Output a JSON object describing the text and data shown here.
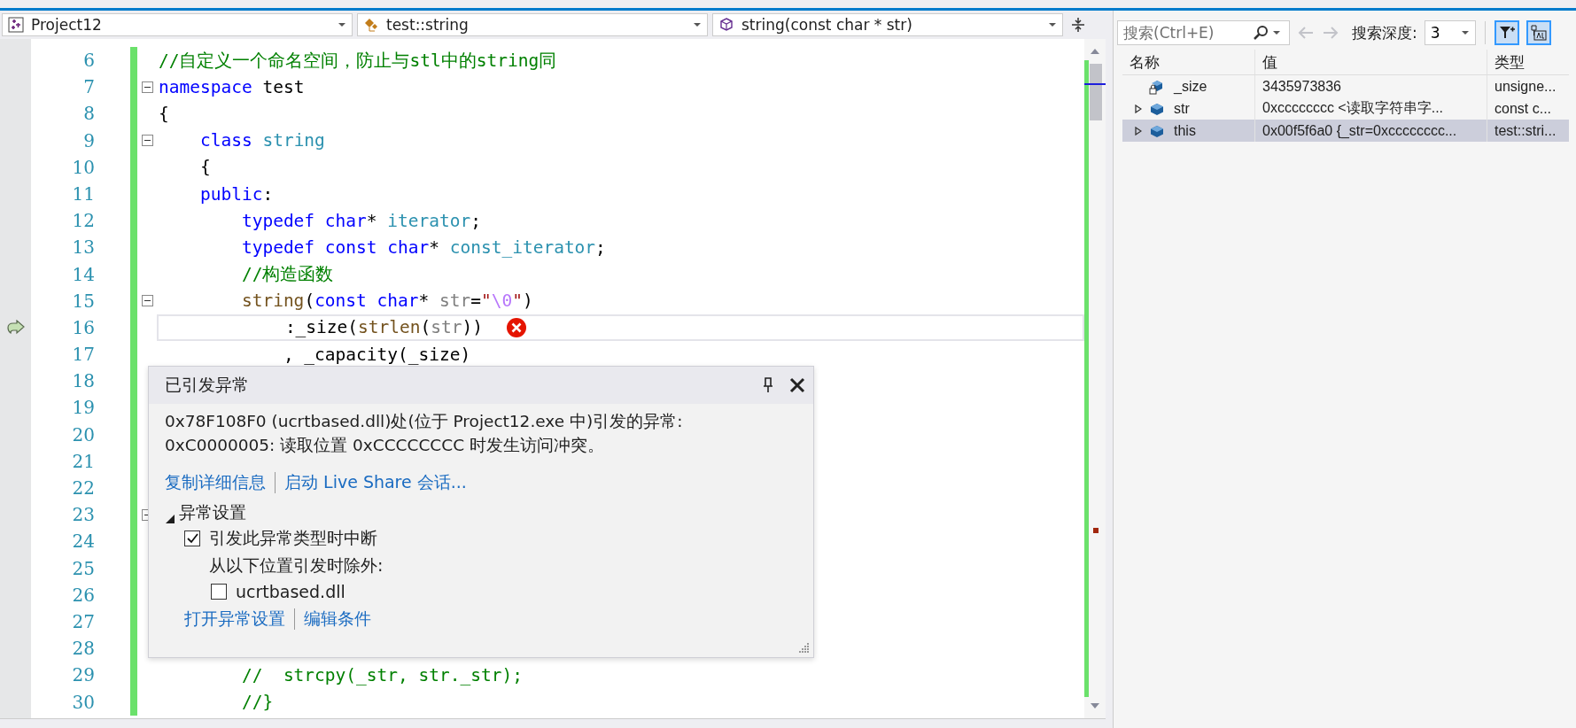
{
  "navigation_bar": [
    {
      "kind": "project",
      "label": "Project12"
    },
    {
      "kind": "class",
      "label": "test::string"
    },
    {
      "kind": "member",
      "label": "string(const char * str)"
    }
  ],
  "editor": {
    "lines": [
      {
        "number": "6",
        "foldable": false,
        "current": false,
        "error": false,
        "tokens": [
          {
            "text": "//自定义一个命名空间，防止与stl中的string同",
            "kind": "comment"
          }
        ]
      },
      {
        "number": "7",
        "foldable": true,
        "current": false,
        "error": false,
        "tokens": [
          {
            "text": "namespace",
            "kind": "keyword"
          },
          {
            "text": " test",
            "kind": "plain"
          }
        ]
      },
      {
        "number": "8",
        "foldable": false,
        "current": false,
        "error": false,
        "tokens": [
          {
            "text": "{",
            "kind": "plain"
          }
        ]
      },
      {
        "number": "9",
        "foldable": true,
        "current": false,
        "error": false,
        "tokens": [
          {
            "text": "    class",
            "kind": "keyword"
          },
          {
            "text": " string",
            "kind": "type"
          }
        ]
      },
      {
        "number": "10",
        "foldable": false,
        "current": false,
        "error": false,
        "tokens": [
          {
            "text": "    {",
            "kind": "plain"
          }
        ]
      },
      {
        "number": "11",
        "foldable": false,
        "current": false,
        "error": false,
        "tokens": [
          {
            "text": "    public",
            "kind": "keyword"
          },
          {
            "text": ":",
            "kind": "plain"
          }
        ]
      },
      {
        "number": "12",
        "foldable": false,
        "current": false,
        "error": false,
        "tokens": [
          {
            "text": "        typedef char",
            "kind": "keyword"
          },
          {
            "text": "*",
            "kind": "plain"
          },
          {
            "text": " iterator",
            "kind": "type"
          },
          {
            "text": ";",
            "kind": "plain"
          }
        ]
      },
      {
        "number": "13",
        "foldable": false,
        "current": false,
        "error": false,
        "tokens": [
          {
            "text": "        typedef const char",
            "kind": "keyword"
          },
          {
            "text": "*",
            "kind": "plain"
          },
          {
            "text": " const_iterator",
            "kind": "type"
          },
          {
            "text": ";",
            "kind": "plain"
          }
        ]
      },
      {
        "number": "14",
        "foldable": false,
        "current": false,
        "error": false,
        "tokens": [
          {
            "text": "        //构造函数",
            "kind": "comment"
          }
        ]
      },
      {
        "number": "15",
        "foldable": true,
        "current": false,
        "error": false,
        "tokens": [
          {
            "text": "        string",
            "kind": "function"
          },
          {
            "text": "(",
            "kind": "plain"
          },
          {
            "text": "const char",
            "kind": "keyword"
          },
          {
            "text": "*",
            "kind": "plain"
          },
          {
            "text": " str",
            "kind": "param"
          },
          {
            "text": "=",
            "kind": "plain"
          },
          {
            "text": "\"",
            "kind": "string"
          },
          {
            "text": "\\0",
            "kind": "escape"
          },
          {
            "text": "\"",
            "kind": "string"
          },
          {
            "text": ")",
            "kind": "plain"
          }
        ]
      },
      {
        "number": "16",
        "foldable": false,
        "current": true,
        "error": true,
        "tokens": [
          {
            "text": "            :_size(",
            "kind": "plain"
          },
          {
            "text": "strlen",
            "kind": "function"
          },
          {
            "text": "(",
            "kind": "plain"
          },
          {
            "text": "str",
            "kind": "param"
          },
          {
            "text": "))",
            "kind": "plain"
          }
        ]
      },
      {
        "number": "17",
        "foldable": false,
        "current": false,
        "error": false,
        "tokens": [
          {
            "text": "            , _capacity(_size)",
            "kind": "plain"
          }
        ]
      },
      {
        "number": "18",
        "foldable": false,
        "current": false
      },
      {
        "number": "19",
        "foldable": false,
        "current": false
      },
      {
        "number": "20",
        "foldable": false,
        "current": false
      },
      {
        "number": "21",
        "foldable": false,
        "current": false
      },
      {
        "number": "22",
        "foldable": false,
        "current": false
      },
      {
        "number": "23",
        "foldable": true,
        "current": false
      },
      {
        "number": "24",
        "foldable": false,
        "current": false
      },
      {
        "number": "25",
        "foldable": false,
        "current": false
      },
      {
        "number": "26",
        "foldable": false,
        "current": false
      },
      {
        "number": "27",
        "foldable": false,
        "current": false
      },
      {
        "number": "28",
        "foldable": false,
        "current": false
      },
      {
        "number": "29",
        "foldable": false,
        "current": false,
        "error": false,
        "tokens": [
          {
            "text": "        //  strcpy(_str, str._str);",
            "kind": "comment"
          }
        ]
      },
      {
        "number": "30",
        "foldable": false,
        "current": false,
        "error": false,
        "tokens": [
          {
            "text": "        //}",
            "kind": "comment"
          }
        ]
      }
    ]
  },
  "exception_popup": {
    "title": "已引发异常",
    "message": [
      "0x78F108F0 (ucrtbased.dll)处(位于 Project12.exe 中)引发的异常:",
      "0xC0000005: 读取位置 0xCCCCCCCC 时发生访问冲突。"
    ],
    "links": [
      "复制详细信息",
      "启动 Live Share 会话..."
    ],
    "settings": {
      "title": "异常设置",
      "expanded": true,
      "break_on": {
        "label": "引发此异常类型时中断",
        "checked": true
      },
      "except_note": "从以下位置引发时除外:",
      "exclusion": {
        "label": "ucrtbased.dll",
        "checked": false
      }
    },
    "footer_links": [
      "打开异常设置",
      "编辑条件"
    ]
  },
  "autos": {
    "search": {
      "placeholder": "搜索(Ctrl+E)"
    },
    "depth_label": "搜索深度:",
    "depth": "3",
    "columns": [
      "名称",
      "值",
      "类型"
    ],
    "rows": [
      {
        "kind": "private",
        "name": "_size",
        "value": "3435973836",
        "type": "unsigne...",
        "expandable": false,
        "selected": false
      },
      {
        "kind": "field",
        "name": "str",
        "value": "0xcccccccc <读取字符串字...",
        "type": "const c...",
        "expandable": true,
        "selected": false
      },
      {
        "kind": "field",
        "name": "this",
        "value": "0x00f5f6a0 {_str=0xcccccccc...",
        "type": "test::stri...",
        "expandable": true,
        "selected": true
      }
    ]
  }
}
